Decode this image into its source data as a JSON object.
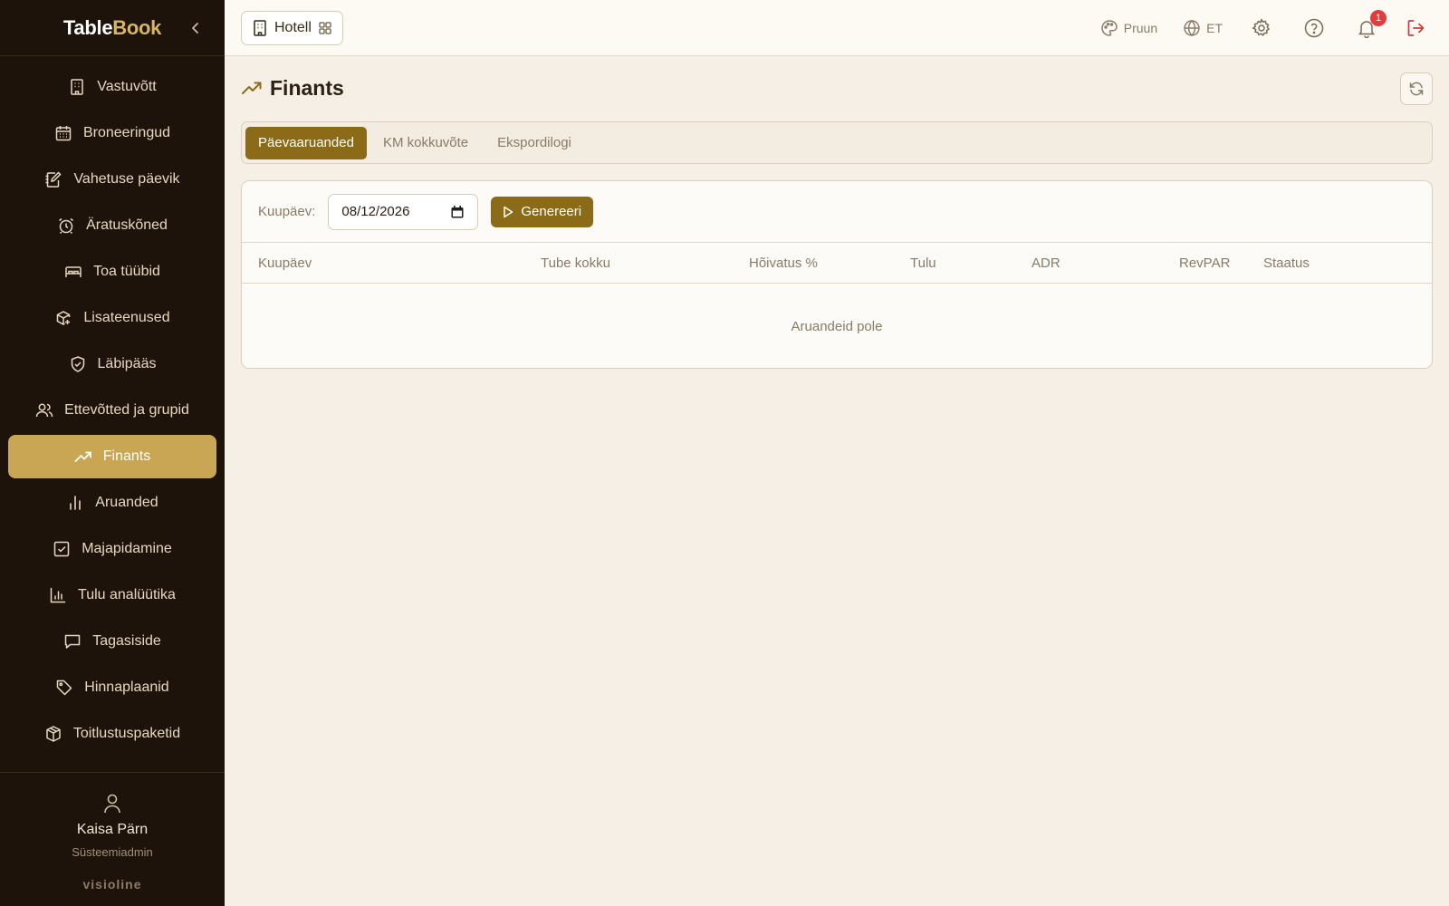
{
  "brand": {
    "name_part1": "Table",
    "name_part2": "Book",
    "accent": "#d6b566"
  },
  "sidebar": {
    "items": [
      {
        "label": "Vastuvõtt",
        "icon": "building-icon",
        "active": false
      },
      {
        "label": "Broneeringud",
        "icon": "calendar-icon",
        "active": false
      },
      {
        "label": "Vahetuse päevik",
        "icon": "edit-note-icon",
        "active": false
      },
      {
        "label": "Äratuskõned",
        "icon": "alarm-clock-icon",
        "active": false
      },
      {
        "label": "Toa tüübid",
        "icon": "bed-icon",
        "active": false
      },
      {
        "label": "Lisateenused",
        "icon": "package-plus-icon",
        "active": false
      },
      {
        "label": "Läbipääs",
        "icon": "shield-check-icon",
        "active": false
      },
      {
        "label": "Ettevõtted ja grupid",
        "icon": "users-icon",
        "active": false
      },
      {
        "label": "Finants",
        "icon": "trending-up-icon",
        "active": true
      },
      {
        "label": "Aruanded",
        "icon": "bar-chart-icon",
        "active": false
      },
      {
        "label": "Majapidamine",
        "icon": "checkbox-icon",
        "active": false
      },
      {
        "label": "Tulu analüütika",
        "icon": "chart-icon",
        "active": false
      },
      {
        "label": "Tagasiside",
        "icon": "message-icon",
        "active": false
      },
      {
        "label": "Hinnaplaanid",
        "icon": "tag-icon",
        "active": false
      },
      {
        "label": "Toitlustuspaketid",
        "icon": "box-icon",
        "active": false
      }
    ],
    "active_color": "#c9a653"
  },
  "user": {
    "name": "Kaisa Pärn",
    "role": "Süsteemiadmin"
  },
  "vendor": "visioline",
  "topbar": {
    "property_label": "Hotell",
    "theme_label": "Pruun",
    "language_label": "ET",
    "notification_count": "1"
  },
  "page": {
    "title": "Finants",
    "tabs": [
      {
        "label": "Päevaaruanded",
        "active": true
      },
      {
        "label": "KM kokkuvõte",
        "active": false
      },
      {
        "label": "Ekspordilogi",
        "active": false
      }
    ],
    "filter": {
      "date_label": "Kuupäev:",
      "date_value": "08/12/2026",
      "generate_label": "Genereeri"
    },
    "table": {
      "columns": [
        "Kuupäev",
        "Tube kokku",
        "Hõivatus %",
        "Tulu",
        "ADR",
        "RevPAR",
        "Staatus"
      ],
      "empty_text": "Aruandeid pole"
    }
  },
  "colors": {
    "primary": "#8b6a18",
    "sidebar_bg": "#1e130a",
    "page_bg": "#f5efe6",
    "badge": "#e23c3c",
    "logout": "#d23a3a"
  }
}
